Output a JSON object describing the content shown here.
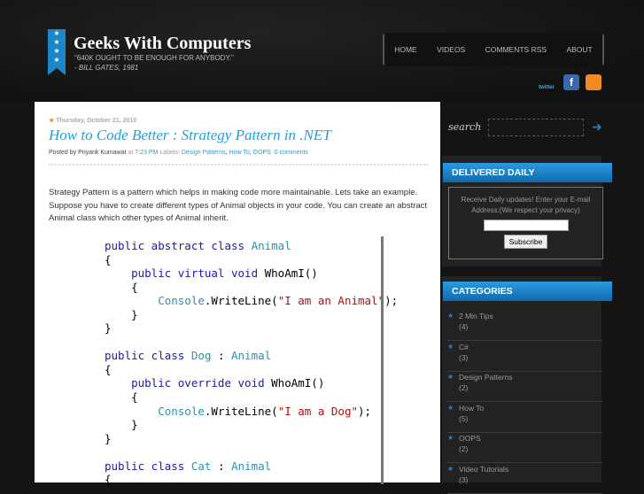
{
  "header": {
    "title": "Geeks With Computers",
    "quote": "\"640K OUGHT TO BE ENOUGH FOR ANYBODY.\"",
    "author": "- BILL GATES, 1981",
    "nav": [
      "HOME",
      "VIDEOS",
      "COMMENTS RSS",
      "ABOUT"
    ],
    "social": {
      "twitter": "twitter",
      "facebook": "f",
      "rss": "rss"
    }
  },
  "post": {
    "date": "Thursday, October 21, 2010",
    "title": "How to Code Better : Strategy Pattern in .NET",
    "posted_by": "Posted by Priyank Kumawat",
    "at": "at",
    "time": "7:23 PM",
    "labels_label": "Labels:",
    "labels": [
      "Design Patterns",
      "How To",
      "OOPS"
    ],
    "comments": "0 comments",
    "body": "Strategy Pattern is a pattern which helps in making code more maintainable. Lets take an example. Suppose you have to create different types of Animal objects in your code. You can create an abstract Animal class which other types of Animal inherit.",
    "code": [
      [
        [
          "kw",
          "public abstract class "
        ],
        [
          "ty",
          "Animal"
        ]
      ],
      [
        [
          "",
          "{"
        ]
      ],
      [
        [
          "kw",
          "    public virtual void "
        ],
        [
          "",
          "WhoAmI()"
        ]
      ],
      [
        [
          "",
          "    {"
        ]
      ],
      [
        [
          "ty",
          "        Console"
        ],
        [
          "",
          ".WriteLine("
        ],
        [
          "st",
          "\"I am an Animal\""
        ],
        [
          "",
          ");"
        ]
      ],
      [
        [
          "",
          "    }"
        ]
      ],
      [
        [
          "",
          "}"
        ]
      ],
      [
        [
          "",
          ""
        ]
      ],
      [
        [
          "kw",
          "public class "
        ],
        [
          "ty",
          "Dog"
        ],
        [
          "",
          " : "
        ],
        [
          "ty",
          "Animal"
        ]
      ],
      [
        [
          "",
          "{"
        ]
      ],
      [
        [
          "kw",
          "    public override void "
        ],
        [
          "",
          "WhoAmI()"
        ]
      ],
      [
        [
          "",
          "    {"
        ]
      ],
      [
        [
          "ty",
          "        Console"
        ],
        [
          "",
          ".WriteLine("
        ],
        [
          "st",
          "\"I am a Dog\""
        ],
        [
          "",
          ");"
        ]
      ],
      [
        [
          "",
          "    }"
        ]
      ],
      [
        [
          "",
          "}"
        ]
      ],
      [
        [
          "",
          ""
        ]
      ],
      [
        [
          "kw",
          "public class "
        ],
        [
          "ty",
          "Cat"
        ],
        [
          "",
          " : "
        ],
        [
          "ty",
          "Animal"
        ]
      ],
      [
        [
          "",
          "{"
        ]
      ]
    ]
  },
  "sidebar": {
    "search_label": "search",
    "delivered_title": "DELIVERED DAILY",
    "delivered_text": "Receive Daily updates! Enter your E-mail Address:(We respect your privacy)",
    "subscribe": "Subscribe",
    "categories_title": "CATEGORIES",
    "categories": [
      {
        "name": "2 Min Tips",
        "count": "(4)"
      },
      {
        "name": "C#",
        "count": "(3)"
      },
      {
        "name": "Design Patterns",
        "count": "(2)"
      },
      {
        "name": "How To",
        "count": "(5)"
      },
      {
        "name": "OOPS",
        "count": "(2)"
      },
      {
        "name": "Video Tutorials",
        "count": "(3)"
      }
    ]
  }
}
